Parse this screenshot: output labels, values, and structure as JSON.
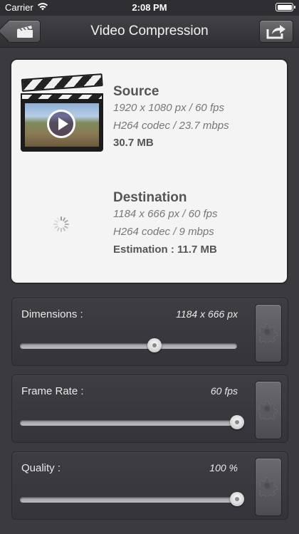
{
  "status": {
    "carrier": "Carrier",
    "time": "2:08 PM"
  },
  "nav": {
    "title": "Video Compression",
    "back_icon": "clapperboard-back-icon",
    "share_icon": "share-icon"
  },
  "source": {
    "heading": "Source",
    "resolution": "1920 x 1080 px / 60 fps",
    "codec": "H264 codec / 23.7 mbps",
    "size": "30.7 MB"
  },
  "destination": {
    "heading": "Destination",
    "resolution": "1184 x 666 px / 60 fps",
    "codec": "H264 codec / 9 mbps",
    "estimation": "Estimation : 11.7 MB"
  },
  "controls": [
    {
      "label": "Dimensions :",
      "value": "1184 x 666 px",
      "level": 0.62
    },
    {
      "label": "Frame Rate :",
      "value": "60 fps",
      "level": 1.0
    },
    {
      "label": "Quality :",
      "value": "100 %",
      "level": 1.0
    }
  ],
  "colors": {
    "background": "#3a3a3f",
    "card": "#f4f4f4",
    "text_dark": "#555555"
  }
}
